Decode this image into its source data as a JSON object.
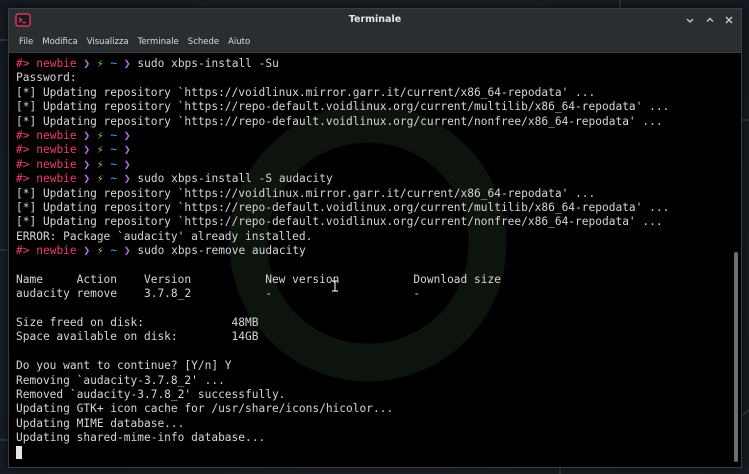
{
  "window": {
    "title": "Terminale"
  },
  "menubar": {
    "items": [
      "File",
      "Modifica",
      "Visualizza",
      "Terminale",
      "Schede",
      "Aiuto"
    ]
  },
  "prompt": {
    "hash": "#>",
    "user": "newbie",
    "sep": "❯",
    "bolt": "⚡",
    "tilde": "~",
    "sep2": "❯"
  },
  "terminal": {
    "lines": [
      {
        "prompt": true,
        "text": "sudo xbps-install -Su"
      },
      {
        "prompt": false,
        "text": "Password:"
      },
      {
        "prompt": false,
        "text": "[*] Updating repository `https://voidlinux.mirror.garr.it/current/x86_64-repodata' ..."
      },
      {
        "prompt": false,
        "text": "[*] Updating repository `https://repo-default.voidlinux.org/current/multilib/x86_64-repodata' ..."
      },
      {
        "prompt": false,
        "text": "[*] Updating repository `https://repo-default.voidlinux.org/current/nonfree/x86_64-repodata' ..."
      },
      {
        "prompt": true,
        "text": ""
      },
      {
        "prompt": true,
        "text": ""
      },
      {
        "prompt": true,
        "text": ""
      },
      {
        "prompt": true,
        "text": "sudo xbps-install -S audacity"
      },
      {
        "prompt": false,
        "text": "[*] Updating repository `https://voidlinux.mirror.garr.it/current/x86_64-repodata' ..."
      },
      {
        "prompt": false,
        "text": "[*] Updating repository `https://repo-default.voidlinux.org/current/multilib/x86_64-repodata' ..."
      },
      {
        "prompt": false,
        "text": "[*] Updating repository `https://repo-default.voidlinux.org/current/nonfree/x86_64-repodata' ..."
      },
      {
        "prompt": false,
        "text": "ERROR: Package `audacity' already installed."
      },
      {
        "prompt": true,
        "text": "sudo xbps-remove audacity"
      },
      {
        "prompt": false,
        "text": ""
      },
      {
        "prompt": false,
        "text": "Name     Action    Version           New version           Download size"
      },
      {
        "prompt": false,
        "text": "audacity remove    3.7.8_2           -                     -"
      },
      {
        "prompt": false,
        "text": ""
      },
      {
        "prompt": false,
        "text": "Size freed on disk:             48MB"
      },
      {
        "prompt": false,
        "text": "Space available on disk:        14GB"
      },
      {
        "prompt": false,
        "text": ""
      },
      {
        "prompt": false,
        "text": "Do you want to continue? [Y/n] Y"
      },
      {
        "prompt": false,
        "text": "Removing `audacity-3.7.8_2' ..."
      },
      {
        "prompt": false,
        "text": "Removed `audacity-3.7.8_2' successfully."
      },
      {
        "prompt": false,
        "text": "Updating GTK+ icon cache for /usr/share/icons/hicolor..."
      },
      {
        "prompt": false,
        "text": "Updating MIME database..."
      },
      {
        "prompt": false,
        "text": "Updating shared-mime-info database..."
      },
      {
        "prompt": false,
        "text": "",
        "cursor": true
      }
    ]
  },
  "colors": {
    "prompt_user": "#ef3b6b",
    "prompt_sep": "#c06cf0",
    "prompt_bolt": "#7fd34a",
    "prompt_tilde": "#4ea3f0",
    "terminal_bg": "#000000",
    "terminal_fg": "#d6d6d6",
    "titlebar_bg": "#2b2e31"
  },
  "icons": {
    "app": "terminal-app-icon",
    "minimize": "minimize-icon",
    "maximize": "maximize-icon",
    "close": "close-icon"
  }
}
